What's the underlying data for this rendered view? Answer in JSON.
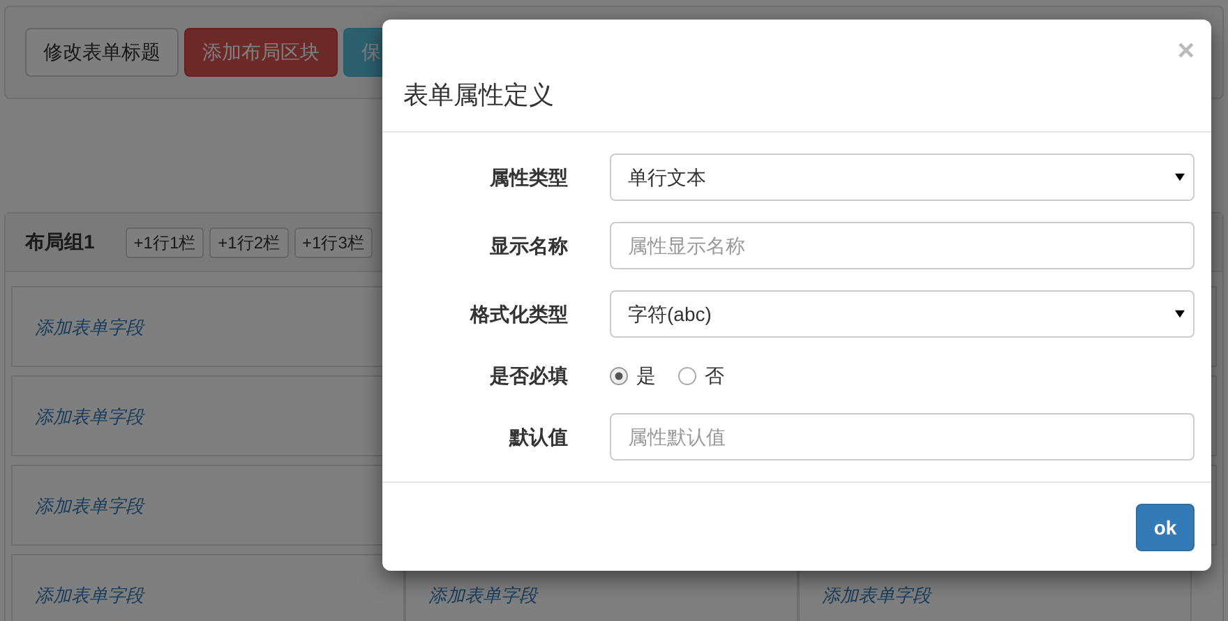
{
  "toolbar": {
    "buttons": [
      {
        "label": "修改表单标题",
        "kind": "default"
      },
      {
        "label": "添加布局区块",
        "kind": "danger"
      },
      {
        "label": "保",
        "kind": "info"
      }
    ]
  },
  "layout_group": {
    "title": "布局组1",
    "buttons": [
      "+1行1栏",
      "+1行2栏",
      "+1行3栏"
    ],
    "rows": [
      {
        "cells": [
          "添加表单字段"
        ]
      },
      {
        "cells": [
          "添加表单字段"
        ]
      },
      {
        "cells": [
          "添加表单字段"
        ]
      },
      {
        "cells": [
          "添加表单字段",
          "添加表单字段",
          "添加表单字段"
        ]
      }
    ]
  },
  "modal": {
    "title": "表单属性定义",
    "close": "×",
    "fields": [
      {
        "label": "属性类型",
        "kind": "select",
        "value": "单行文本"
      },
      {
        "label": "显示名称",
        "kind": "input",
        "placeholder": "属性显示名称"
      },
      {
        "label": "格式化类型",
        "kind": "select",
        "value": "字符(abc)"
      },
      {
        "label": "是否必填",
        "kind": "radio",
        "options": [
          {
            "label": "是",
            "selected": true
          },
          {
            "label": "否",
            "selected": false
          }
        ]
      },
      {
        "label": "默认值",
        "kind": "input",
        "placeholder": "属性默认值"
      }
    ],
    "ok_button": "ok"
  }
}
